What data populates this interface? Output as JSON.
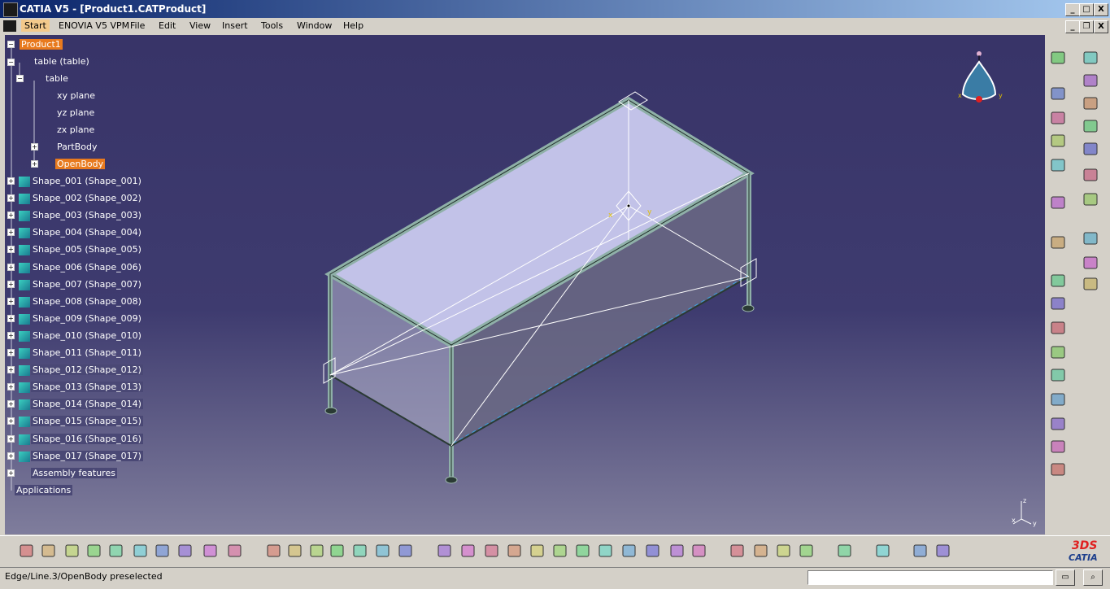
{
  "window": {
    "title": "CATIA V5 - [Product1.CATProduct]",
    "controls": {
      "minimize": "_",
      "maximize": "□",
      "close": "X"
    },
    "doc_controls": {
      "minimize": "_",
      "restore": "❐",
      "close": "X"
    }
  },
  "menu": {
    "items": [
      "Start",
      "ENOVIA V5 VPM",
      "File",
      "Edit",
      "View",
      "Insert",
      "Tools",
      "Window",
      "Help"
    ]
  },
  "tree": {
    "root": "Product1",
    "part": "table (table)",
    "part_body": "table",
    "planes": [
      "xy plane",
      "yz plane",
      "zx plane"
    ],
    "bodies": [
      "PartBody",
      "OpenBody"
    ],
    "shapes": [
      "Shape_001 (Shape_001)",
      "Shape_002 (Shape_002)",
      "Shape_003 (Shape_003)",
      "Shape_004 (Shape_004)",
      "Shape_005 (Shape_005)",
      "Shape_006 (Shape_006)",
      "Shape_007 (Shape_007)",
      "Shape_008 (Shape_008)",
      "Shape_009 (Shape_009)",
      "Shape_010 (Shape_010)",
      "Shape_011 (Shape_011)",
      "Shape_012 (Shape_012)",
      "Shape_013 (Shape_013)",
      "Shape_014 (Shape_014)",
      "Shape_015 (Shape_015)",
      "Shape_016 (Shape_016)",
      "Shape_017 (Shape_017)"
    ],
    "assembly": "Assembly features",
    "applications": "Applications"
  },
  "compass": {
    "x": "x",
    "y": "y",
    "z": "z"
  },
  "axis_triad": {
    "x": "x",
    "y": "y",
    "z": "z"
  },
  "status": {
    "message": "Edge/Line.3/OpenBody preselected"
  },
  "brand": {
    "logo": "CATIA"
  },
  "colors": {
    "accent": "#e87a1e",
    "background_top": "#383468",
    "background_bottom": "#7f7d9c",
    "title_bar": "#0a246a"
  },
  "toolbar_icons": {
    "bottom": [
      "new-icon",
      "open-icon",
      "save-icon",
      "print-icon",
      "cut-icon",
      "copy-icon",
      "paste-icon",
      "undo-icon",
      "redo-icon",
      "whats-this-icon",
      "formula-icon",
      "knowledge-icon",
      "lock-icon",
      "table-icon",
      "tree-icon",
      "catalog-icon",
      "measure-icon",
      "fly-icon",
      "fit-all-icon",
      "pan-icon",
      "rotate-icon",
      "zoom-in-icon",
      "zoom-out-icon",
      "normal-view-icon",
      "multi-view-icon",
      "iso-view-icon",
      "shading-icon",
      "hide-show-icon",
      "swap-icon",
      "snap-icon",
      "explode-icon",
      "filter-icon",
      "capture-icon",
      "refresh-icon",
      "measure-between-icon",
      "measure-item-icon",
      "inertia-icon"
    ],
    "right": [
      "product-icon",
      "component-icon",
      "existing-component-icon",
      "replace-icon",
      "graph-icon",
      "reorder-icon",
      "numbering-icon",
      "manipulate-icon",
      "snap-icon",
      "constraint-icon",
      "fix-icon",
      "coincidence-icon",
      "contact-icon",
      "offset-icon",
      "angle-icon",
      "reuse-pattern-icon",
      "update-icon",
      "explode-icon",
      "clash-icon",
      "sectioning-icon",
      "distance-icon",
      "scenes-icon",
      "enhanced-scene-icon",
      "export-icon",
      "import-icon",
      "selection-arrow-icon"
    ]
  }
}
